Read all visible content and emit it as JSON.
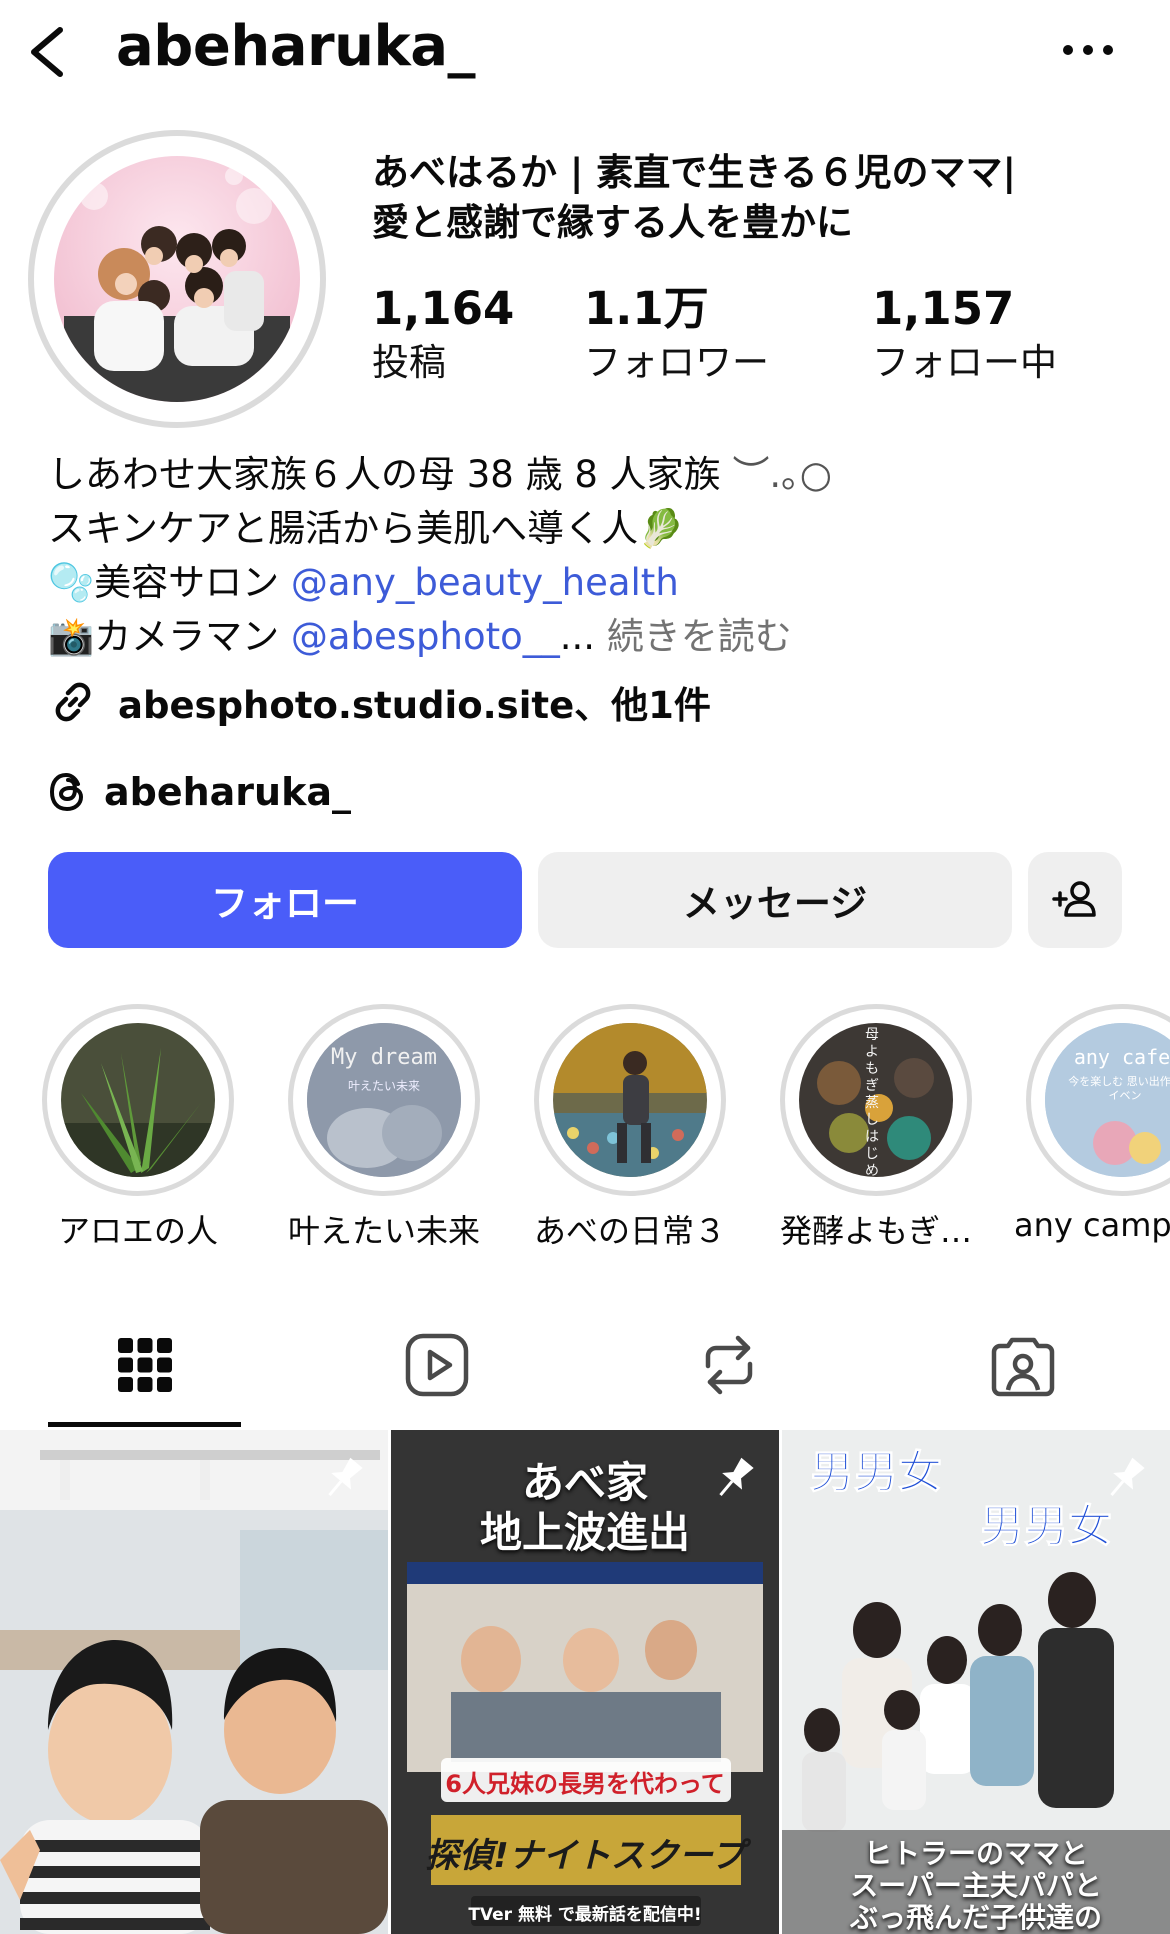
{
  "header": {
    "username": "abeharuka_",
    "back_icon": "chevron-left-icon",
    "more_icon": "more-horizontal-icon"
  },
  "profile": {
    "display_name_line1": "あべはるか | 素直で生きる６児のママ|",
    "display_name_line2": "愛と感謝で縁する人を豊かに",
    "stats": [
      {
        "value": "1,164",
        "label": "投稿"
      },
      {
        "value": "1.1万",
        "label": "フォロワー"
      },
      {
        "value": "1,157",
        "label": "フォロー中"
      }
    ]
  },
  "bio": {
    "line1": "しあわせ大家族６人の母 38 歳 8 人家族",
    "line1_deco": "︶.｡○",
    "line2": "スキンケアと腸活から美肌へ導く人",
    "line2_emoji": "🥬",
    "line3_emoji": "🫧",
    "line3_text": "美容サロン ",
    "line3_mention": "@any_beauty_health",
    "line4_emoji": "📸",
    "line4_text": "カメラマン ",
    "line4_mention": "@abesphoto__",
    "line4_ellipsis": "... ",
    "read_more": "続きを読む"
  },
  "links": {
    "website": "abesphoto.studio.site、他1件",
    "threads_handle": "abeharuka_"
  },
  "actions": {
    "follow_label": "フォロー",
    "message_label": "メッセージ",
    "suggest_icon": "add-person-icon"
  },
  "highlights": [
    {
      "label": "アロエの人",
      "cover_text": ""
    },
    {
      "label": "叶えたい未来",
      "cover_text": "My dream",
      "cover_sub": "叶えたい未来"
    },
    {
      "label": "あべの日常３",
      "cover_text": ""
    },
    {
      "label": "発酵よもぎ…",
      "cover_text": "母よもぎ蒸しはじめま"
    },
    {
      "label": "any camp",
      "cover_text": "any cafe",
      "cover_sub": "今を楽しむ 思い出作りイベン"
    }
  ],
  "tabs": [
    {
      "name": "grid",
      "icon": "grid-icon"
    },
    {
      "name": "reels",
      "icon": "reels-icon"
    },
    {
      "name": "reposts",
      "icon": "repost-icon"
    },
    {
      "name": "tagged",
      "icon": "tagged-person-icon"
    }
  ],
  "posts": [
    {
      "pinned": true,
      "caption": ""
    },
    {
      "pinned": true,
      "caption_line1": "あべ家",
      "caption_line2": "地上波進出",
      "banner": "6人兄妹の長男を代わって",
      "logo": "探偵!ナイトスクープ",
      "footer": "TVer 無料 で最新話を配信中!"
    },
    {
      "pinned": true,
      "caption_top1": "男男女",
      "caption_top2": "男男女",
      "caption_bottom1": "ヒトラーのママと",
      "caption_bottom2": "スーパー主夫パパと",
      "caption_bottom3": "ぶっ飛んだ子供達の"
    }
  ]
}
